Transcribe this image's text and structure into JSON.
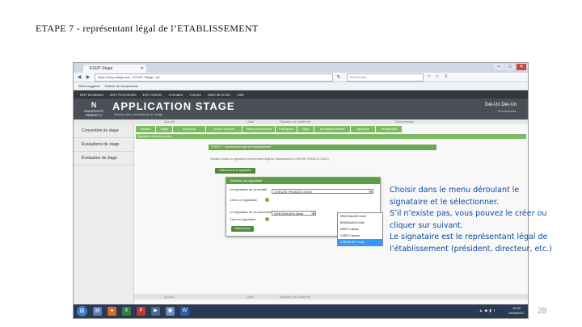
{
  "slide": {
    "title": "ETAPE 7 - représentant légal de l’ETABLISSEMENT",
    "page_number": "28"
  },
  "browser": {
    "tab_title": "ESUP-Stage",
    "url": "https://esup-stage.univ.../ESUP_Stage/...jsf",
    "search_placeholder": "Rechercher",
    "bookmarks": [
      "Sites suggérés",
      "Galerie de composants"
    ]
  },
  "ent_bar": [
    "ENT Etudiants",
    "ENT Personnels",
    "ENT Alumni",
    "Annuaire",
    "Cursus",
    "Sites de la fac",
    "Aide"
  ],
  "app": {
    "title": "APPLICATION STAGE",
    "subtitle": "Gestion des conventions de stage",
    "logo_mark": "N",
    "logo_text": "UNIVERSITÉ RENNES 2",
    "user_name": "Dei-Un Dei-Un",
    "user_logout": "Déconnexion",
    "status_left": "Accueil",
    "status_mid": "Aide",
    "status_right": "Signaler un problème",
    "status_far": "Déconnexion"
  },
  "sidebar": {
    "items": [
      "Convention de stage",
      "Évaluations de stage",
      "Évaluation de stage"
    ]
  },
  "tabs": [
    "Étudiant",
    "Stage",
    "Entreprise",
    "Service d'accueil",
    "Tuteur professionnel",
    "Enseignant",
    "Stage",
    "Enseignant référent",
    "Signataire",
    "Récapitulatif"
  ],
  "main": {
    "strip_label": "Signataire choisi ou à créer",
    "section_title": "ÉTAPE 7 : représentant légal de l'établissement",
    "info_text": "Veuillez choisir un signataire (représentant légal de l'établissement CREUSE FRANCE CHAIX)",
    "btn_select": "Sélectionner le signataire",
    "btn_create": "Créer"
  },
  "dialog": {
    "title": "Sélection du signataire",
    "row1_label": "Le signataire de la société",
    "row1_value": "CREUSE FRANCE CHAIX",
    "row2_label": "Créer un signataire",
    "row3_label": "Le signataire de la convention",
    "row3_value": "DREGNAUDH Dede",
    "row4_label": "Créer le signataire",
    "btn_validate": "Sélectionner"
  },
  "dropdown": {
    "options": [
      "DREGNAUDH Dede",
      "BRISSAUDH Dede",
      "MARTI Lisiane",
      "CARDI Lissane",
      "CREDAUDIT Dede"
    ],
    "selected_index": 4
  },
  "bottom_bar": {
    "left": "Accueil",
    "mid": "Aide",
    "right": "Signaler un problème"
  },
  "taskbar": {
    "clock_time": "10:42",
    "clock_date": "15/06/2017"
  },
  "callout": {
    "lines": [
      "Choisir dans le menu déroulant le",
      "signataire et le sélectionner.",
      " S’il n’existe pas, vous pouvez le créer ou",
      "cliquer sur suivant.",
      "Le signataire est le représentant légal de",
      "l’établissement (président, directeur, etc.)"
    ]
  },
  "colors": {
    "accent_green": "#7dbb63",
    "header_dark": "#4a4f55",
    "callout_blue": "#0b4aa0",
    "dropdown_selected": "#3399ff"
  }
}
